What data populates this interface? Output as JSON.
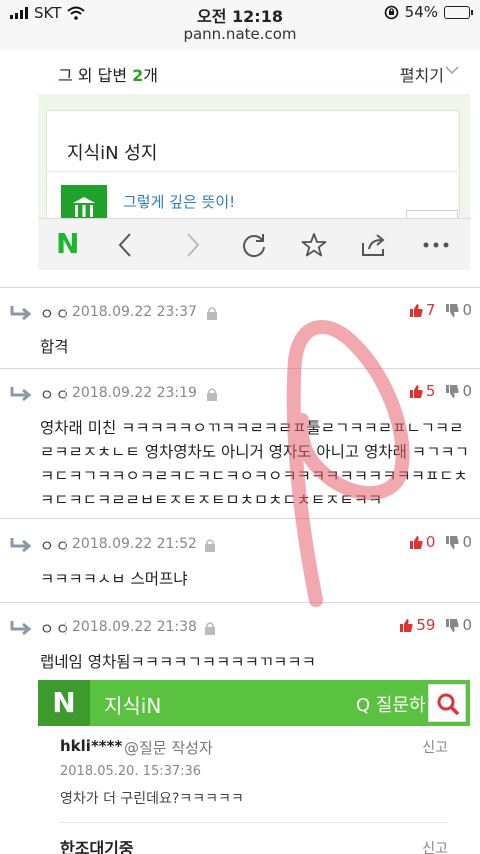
{
  "status_bar": {
    "carrier": "SKT",
    "time": "오전 12:18",
    "url": "pann.nate.com",
    "battery": "54%",
    "battery_level": 0.54
  },
  "embed": {
    "more_answers_prefix": "그 외 답변 ",
    "more_answers_count": "2",
    "more_answers_suffix": "개",
    "expand_label": "펼치기",
    "card_title": "지식iN 성지",
    "link_text": "그렇게 깊은 뜻이!"
  },
  "toolbar": {
    "logo": "N",
    "icons": [
      "back-icon",
      "forward-icon",
      "refresh-icon",
      "star-icon",
      "share-icon",
      "more-icon"
    ]
  },
  "comments": [
    {
      "author": "ㅇㅇ",
      "date": "2018.09.22 23:37",
      "up": "7",
      "down": "0",
      "text": "합격"
    },
    {
      "author": "ㅇㅇ",
      "date": "2018.09.22 23:19",
      "up": "5",
      "down": "0",
      "text": "영차래 미친 ㅋㅋㅋㅋㅋㅇㄲㅋㅋㄹㅋㄹㅍ툴ㄹㄱㅋㅋㄹㅍㄴㄱㅋㄹㄹㅋㄹㅈㅊㄴㅌ 영차영차도 아니거 영자도 아니고 영차래 ㅋㄱㅋㄱㅋㄷㅋㄱㅋㅋㅇㅋㄹㅋㄷㅋㄷㅋㅇㅋㅇㅋㅋㅋㅋㅋㅋㅋㅋㅋㅋㅍㄷㅊㅋㄷㅋㄷㅋㄹㄹㅂㅌㅈㅌㅈㅌㅁㅊㅁㅊㄷㅊㅌㅈㅌㅋㅋ"
    },
    {
      "author": "ㅇㅇ",
      "date": "2018.09.22 21:52",
      "up": "0",
      "down": "0",
      "text": "ㅋㅋㅋㅋㅅㅂ 스머프냐"
    },
    {
      "author": "ㅇㅇ",
      "date": "2018.09.22 21:38",
      "up": "59",
      "down": "0",
      "text": "랩네임 영차됨ㅋㅋㅋㅋㄱㅋㅋㅋㅋㄲㅋㅋㅋ"
    }
  ],
  "kin": {
    "logo": "N",
    "title": "지식iN",
    "question_label": "Q 질문하",
    "user": "hkli****",
    "role": "@질문 작성자",
    "report": "신고",
    "date": "2018.05.20. 15:37:36",
    "text": "영차가 더 구린데요?ㅋㅋㅋㅋㅋ",
    "next_title": "한조대기중",
    "report2": "신고"
  },
  "colors": {
    "green": "#5ac240",
    "dark_green": "#3c9b2c",
    "thumb_up": "#dd3333",
    "scribble": "#e8606e"
  }
}
